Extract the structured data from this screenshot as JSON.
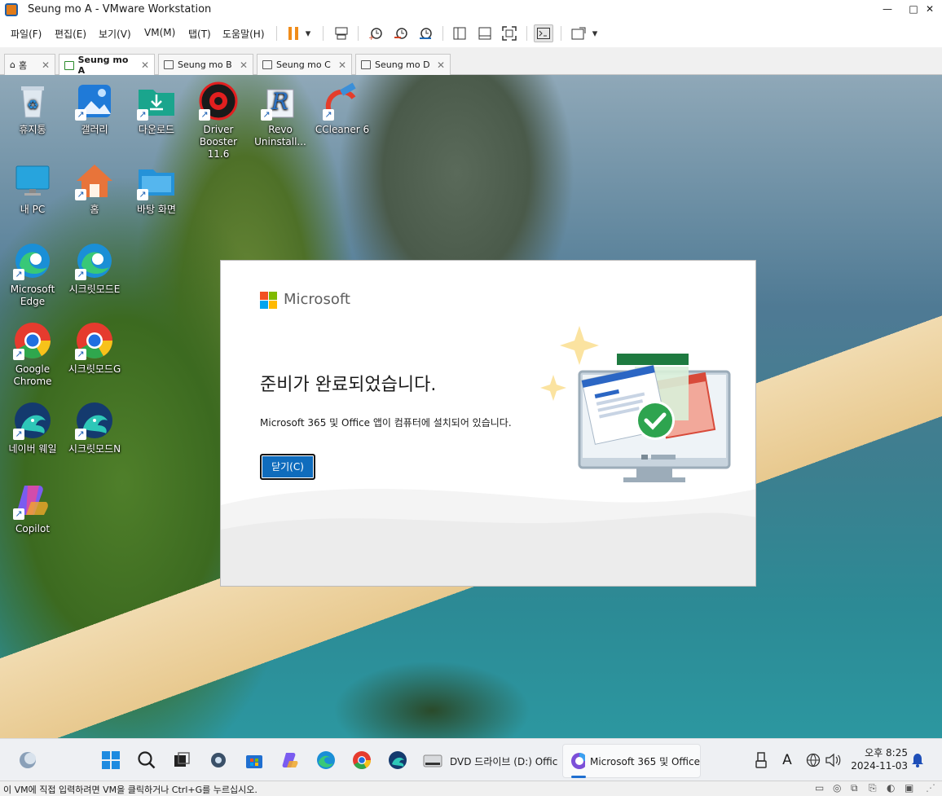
{
  "window": {
    "title": "Seung mo A - VMware Workstation",
    "controls": {
      "minimize": "—",
      "maximize": "□",
      "close": "✕"
    }
  },
  "menubar": {
    "items": [
      "파일(F)",
      "편집(E)",
      "보기(V)",
      "VM(M)",
      "탭(T)",
      "도움말(H)"
    ]
  },
  "toolbar": {
    "icons": [
      "pause-icon",
      "dropdown-icon",
      "send-keys-icon",
      "snapshot-take-icon",
      "snapshot-revert-icon",
      "snapshot-manager-icon",
      "library-view-icon",
      "thumbnail-view-icon",
      "fullscreen-icon",
      "console-view-icon",
      "unity-icon",
      "dropdown-icon"
    ],
    "accent": "#f08c1a"
  },
  "tabs": [
    {
      "label": "홈"
    },
    {
      "label": "Seung mo A"
    },
    {
      "label": "Seung mo B"
    },
    {
      "label": "Seung mo C"
    },
    {
      "label": "Seung mo D"
    }
  ],
  "desktop": {
    "icons": [
      {
        "label": "휴지통",
        "icon": "recycle-bin-icon"
      },
      {
        "label": "갤러리",
        "icon": "gallery-icon"
      },
      {
        "label": "다운로드",
        "icon": "downloads-folder-icon"
      },
      {
        "label": "Driver Booster 11.6",
        "icon": "driver-booster-icon"
      },
      {
        "label": "Revo Uninstall...",
        "icon": "revo-uninstaller-icon"
      },
      {
        "label": "CCleaner 6",
        "icon": "ccleaner-icon"
      },
      {
        "label": "내 PC",
        "icon": "this-pc-icon"
      },
      {
        "label": "홈",
        "icon": "home-icon"
      },
      {
        "label": "바탕 화면",
        "icon": "desktop-folder-icon"
      },
      {
        "label": "Microsoft Edge",
        "icon": "edge-icon"
      },
      {
        "label": "시크릿모드E",
        "icon": "edge-icon"
      },
      {
        "label": "Google Chrome",
        "icon": "chrome-icon"
      },
      {
        "label": "시크릿모드G",
        "icon": "chrome-icon"
      },
      {
        "label": "네이버 웨일",
        "icon": "whale-icon"
      },
      {
        "label": "시크릿모드N",
        "icon": "whale-icon"
      },
      {
        "label": "Copilot",
        "icon": "copilot-icon"
      }
    ]
  },
  "dialog": {
    "brand": "Microsoft",
    "title": "준비가 완료되었습니다.",
    "message": "Microsoft 365 및 Office 앱이 컴퓨터에 설치되어 있습니다.",
    "close_button": "닫기(C)",
    "brand_colors": [
      "#f25022",
      "#7fba00",
      "#00a4ef",
      "#ffb900"
    ]
  },
  "taskbar": {
    "dvd_label": "DVD 드라이브 (D:) Offic",
    "m365_label": "Microsoft 365 및 Office",
    "time": "오후 8:25",
    "date": "2024-11-03",
    "ime": "A"
  },
  "status": {
    "message": "이 VM에 직접 입력하려면 VM을 클릭하거나 Ctrl+G를 누르십시오."
  }
}
